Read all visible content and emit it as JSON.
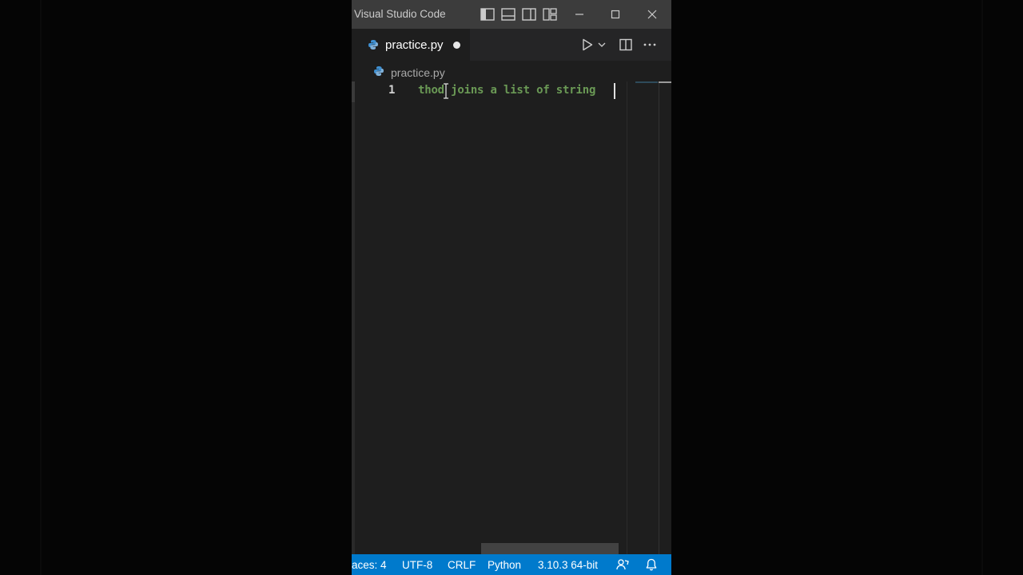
{
  "window": {
    "title": "Visual Studio Code"
  },
  "titlebar_icons": [
    "toggle-primary-sidebar-icon",
    "toggle-panel-icon",
    "toggle-secondary-sidebar-icon",
    "customize-layout-icon",
    "minimize-icon",
    "maximize-icon",
    "close-icon"
  ],
  "tab": {
    "label": "practice.py",
    "dirty": true
  },
  "editor_actions": [
    "run-icon",
    "chevron-down-icon",
    "split-editor-icon",
    "more-actions-icon"
  ],
  "breadcrumb": {
    "file": "practice.py"
  },
  "editor": {
    "lines": [
      {
        "number": "1",
        "text": "thod joins a list of string"
      }
    ],
    "comment_color": "#6a9955"
  },
  "statusbar": {
    "indentation": "aces: 4",
    "encoding": "UTF-8",
    "eol": "CRLF",
    "language": "Python",
    "interpreter": "3.10.3 64-bit",
    "background": "#007acc"
  }
}
